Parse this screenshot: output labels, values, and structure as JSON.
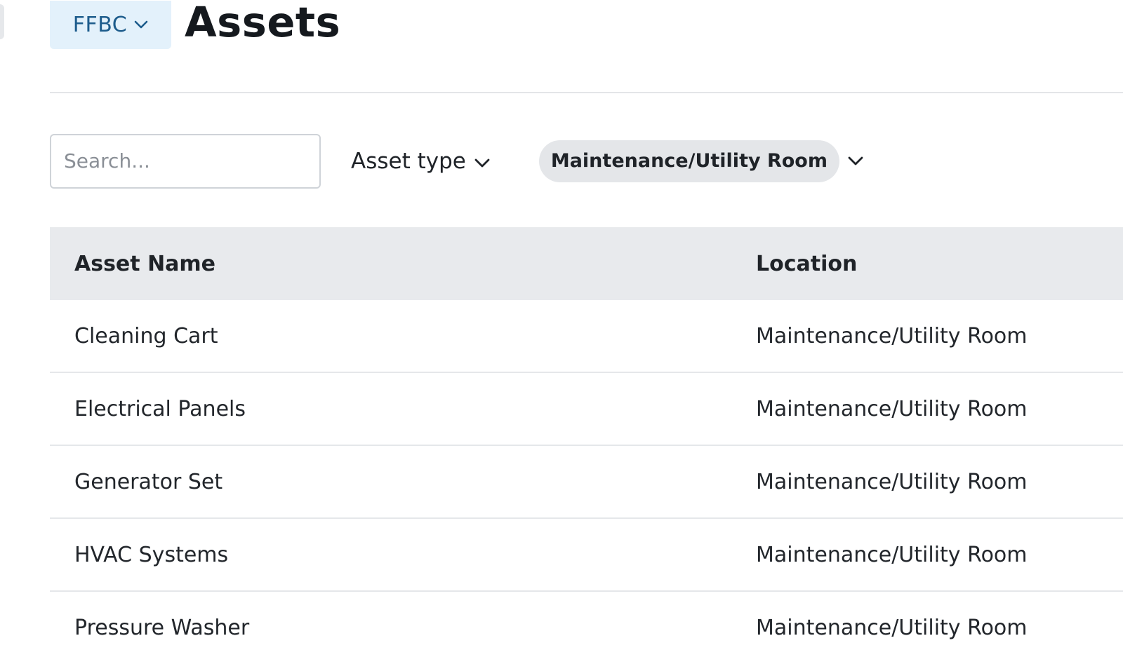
{
  "header": {
    "org_label": "FFBC",
    "title": "Assets"
  },
  "filters": {
    "search_placeholder": "Search...",
    "asset_type_label": "Asset type",
    "location_chip": "Maintenance/Utility Room"
  },
  "table": {
    "columns": [
      "Asset Name",
      "Location"
    ],
    "rows": [
      {
        "name": "Cleaning Cart",
        "location": "Maintenance/Utility Room"
      },
      {
        "name": "Electrical Panels",
        "location": "Maintenance/Utility Room"
      },
      {
        "name": "Generator Set",
        "location": "Maintenance/Utility Room"
      },
      {
        "name": "HVAC Systems",
        "location": "Maintenance/Utility Room"
      },
      {
        "name": "Pressure Washer",
        "location": "Maintenance/Utility Room"
      }
    ]
  },
  "colors": {
    "org_bg": "#e3f1fb",
    "org_text": "#1d5c8c",
    "header_row_bg": "#e8eaed",
    "chip_bg": "#e4e6e9"
  }
}
